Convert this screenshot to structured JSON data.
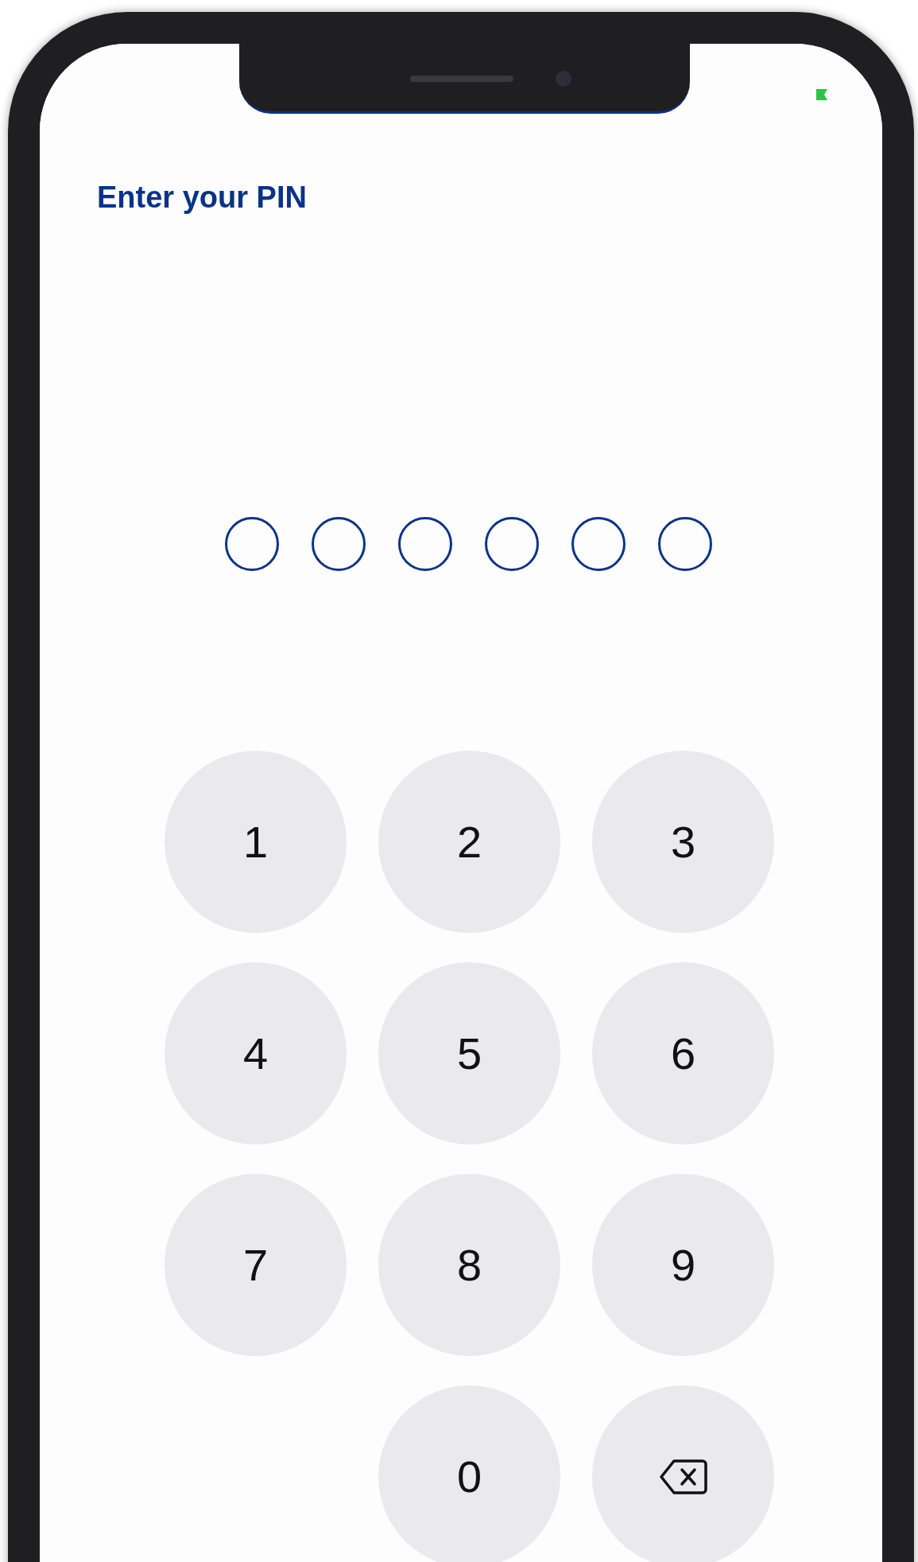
{
  "screen": {
    "title": "Enter your PIN"
  },
  "pin_dots": [
    {
      "filled": false
    },
    {
      "filled": false
    },
    {
      "filled": false
    },
    {
      "filled": false
    },
    {
      "filled": false
    },
    {
      "filled": false
    }
  ],
  "keypad": [
    {
      "kind": "digit",
      "label": "1"
    },
    {
      "kind": "digit",
      "label": "2"
    },
    {
      "kind": "digit",
      "label": "3"
    },
    {
      "kind": "digit",
      "label": "4"
    },
    {
      "kind": "digit",
      "label": "5"
    },
    {
      "kind": "digit",
      "label": "6"
    },
    {
      "kind": "digit",
      "label": "7"
    },
    {
      "kind": "digit",
      "label": "8"
    },
    {
      "kind": "digit",
      "label": "9"
    },
    {
      "kind": "blank"
    },
    {
      "kind": "digit",
      "label": "0"
    },
    {
      "kind": "backspace"
    }
  ]
}
